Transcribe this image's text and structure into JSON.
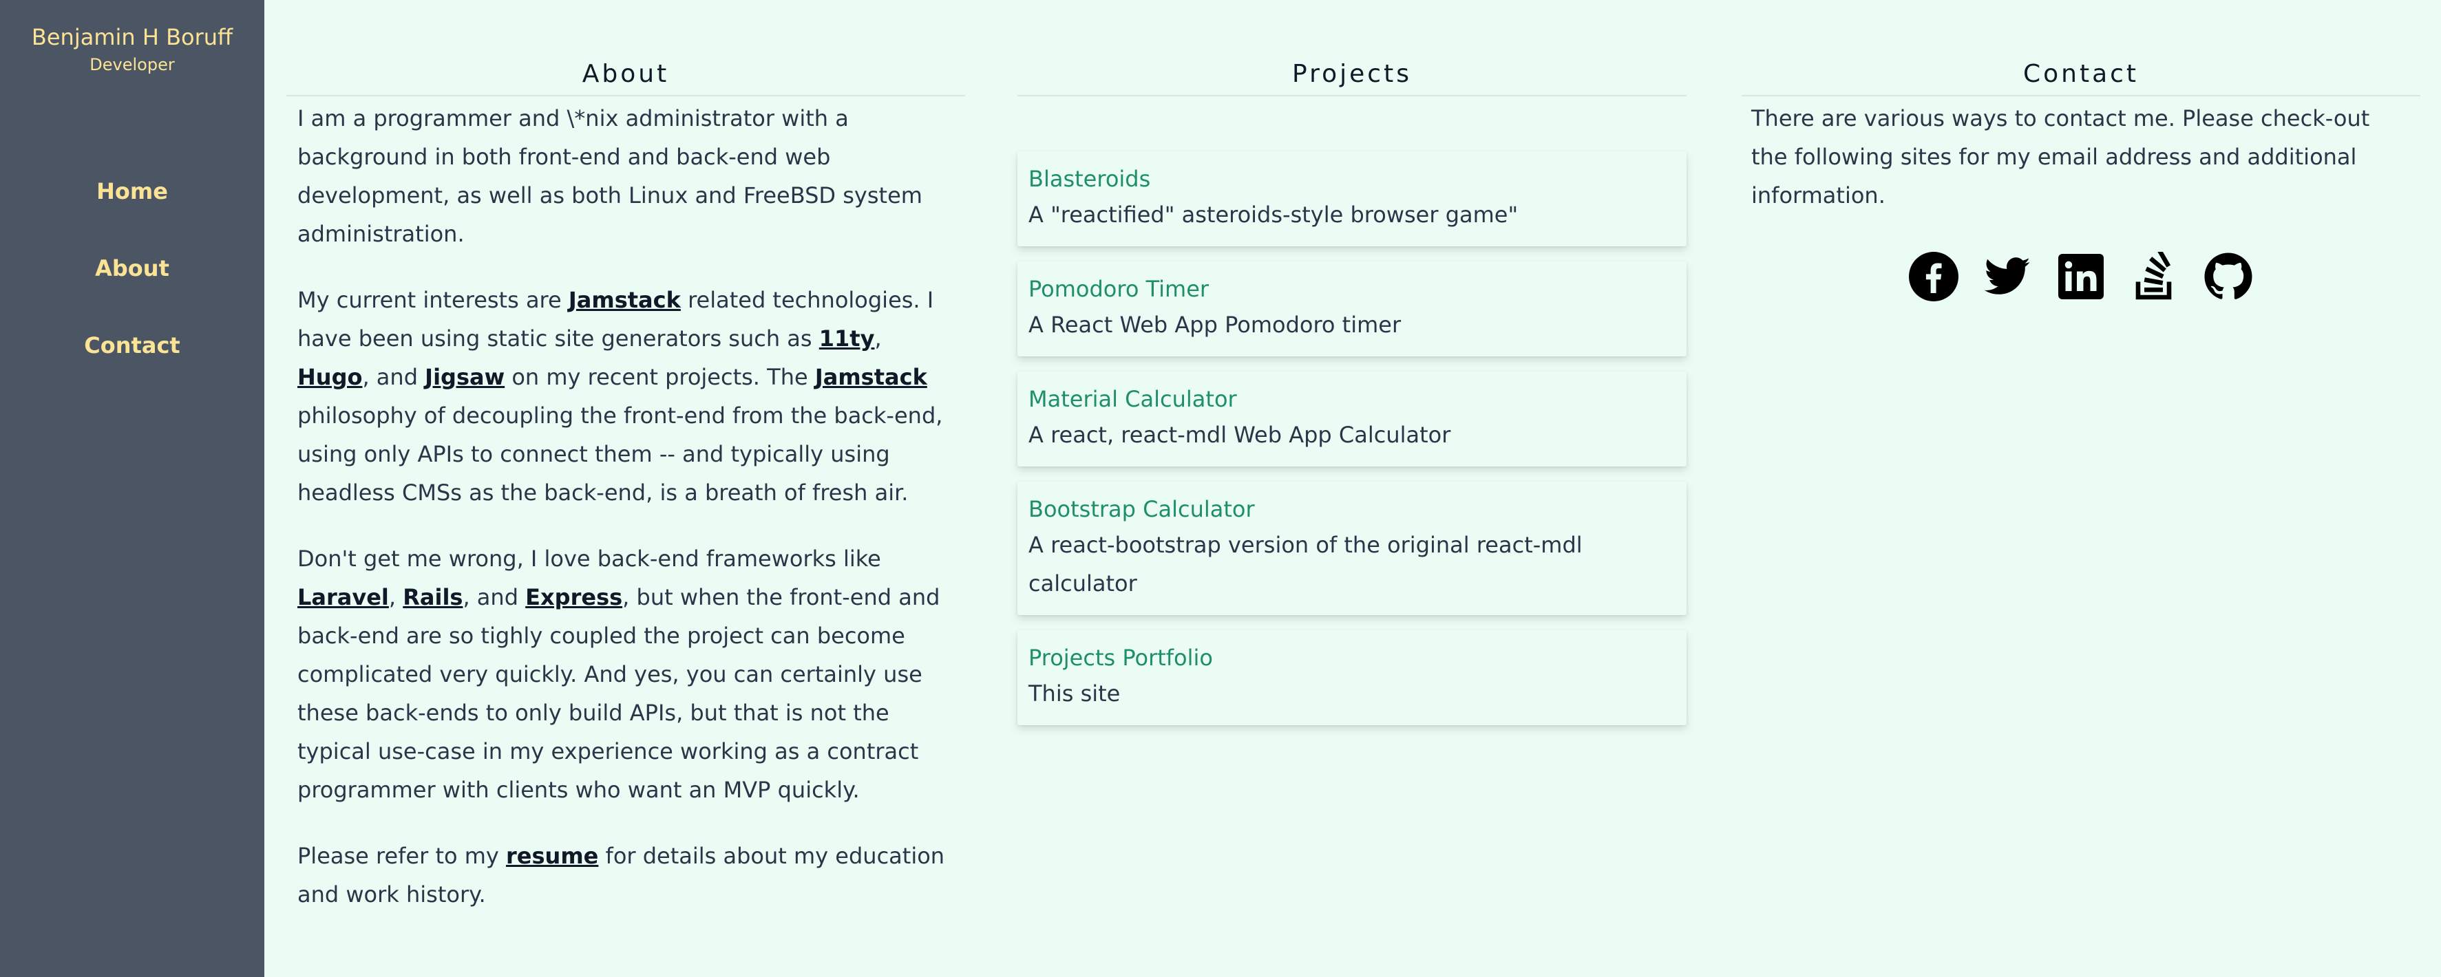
{
  "colors": {
    "sidebar_bg": "#4b5563",
    "accent": "#fbe396",
    "page_bg": "#ebfcf4",
    "link_green": "#1f8f69"
  },
  "sidebar": {
    "name": "Benjamin H Boruff",
    "role": "Developer",
    "nav": [
      {
        "label": "Home"
      },
      {
        "label": "About"
      },
      {
        "label": "Contact"
      }
    ]
  },
  "about": {
    "heading": "About",
    "p1": "I am a programmer and \\*nix administrator with a background in both front-end and back-end web development, as well as both Linux and FreeBSD system administration.",
    "p2": {
      "t1": "My current interests are ",
      "l1": "Jamstack",
      "t2": " related technologies. I have been using static site generators such as ",
      "l2": "11ty",
      "t3": ", ",
      "l3": "Hugo",
      "t4": ", and ",
      "l4": "Jigsaw",
      "t5": " on my recent projects. The ",
      "l5": "Jamstack",
      "t6": " philosophy of decoupling the front-end from the back-end, using only APIs to connect them -- and typically using headless CMSs as the back-end, is a breath of fresh air."
    },
    "p3": {
      "t1": "Don't get me wrong, I love back-end frameworks like ",
      "l1": "Laravel",
      "t2": ", ",
      "l2": "Rails",
      "t3": ", and ",
      "l3": "Express",
      "t4": ", but when the front-end and back-end are so tighly coupled the project can become complicated very quickly. And yes, you can certainly use these back-ends to only build APIs, but that is not the typical use-case in my experience working as a contract programmer with clients who want an MVP quickly."
    },
    "p4": {
      "t1": "Please refer to my ",
      "l1": "resume",
      "t2": " for details about my education and work history."
    }
  },
  "projects": {
    "heading": "Projects",
    "items": [
      {
        "title": "Blasteroids",
        "desc": "A \"reactified\" asteroids-style browser game\""
      },
      {
        "title": "Pomodoro Timer",
        "desc": "A React Web App Pomodoro timer"
      },
      {
        "title": "Material Calculator",
        "desc": "A react, react-mdl Web App Calculator"
      },
      {
        "title": "Bootstrap Calculator",
        "desc": "A react-bootstrap version of the original react-mdl calculator"
      },
      {
        "title": "Projects Portfolio",
        "desc": "This site"
      }
    ]
  },
  "contact": {
    "heading": "Contact",
    "text": "There are various ways to contact me. Please check-out the following sites for my email address and additional information.",
    "socials": [
      "facebook-icon",
      "twitter-icon",
      "linkedin-icon",
      "stackoverflow-icon",
      "github-icon"
    ]
  }
}
